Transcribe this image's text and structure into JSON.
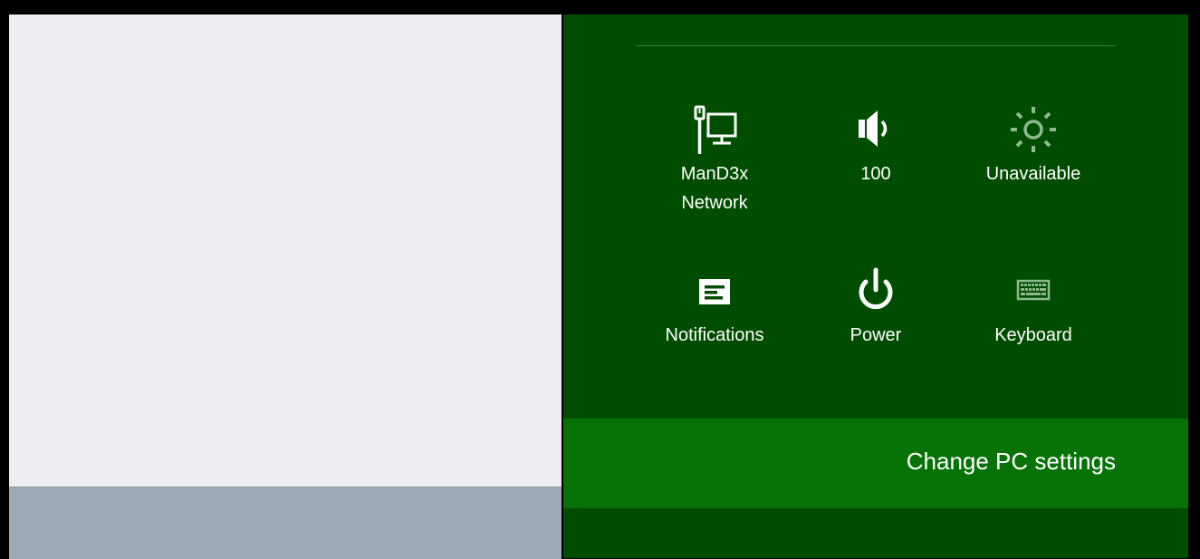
{
  "colors": {
    "charm_background": "#004D00",
    "change_pc_background": "#077307",
    "left_pane_background": "#ECEEF2",
    "left_strip_background": "#9AABB5",
    "icon_white": "#FFFFFF",
    "icon_dim": "#8FB98F"
  },
  "quick_settings": [
    {
      "label": "ManD3x\nNetwork",
      "icon": "network-wired-icon"
    },
    {
      "label": "100",
      "icon": "volume-icon"
    },
    {
      "label": "Unavailable",
      "icon": "brightness-icon"
    },
    {
      "label": "Notifications",
      "icon": "notifications-icon"
    },
    {
      "label": "Power",
      "icon": "power-icon"
    },
    {
      "label": "Keyboard",
      "icon": "keyboard-icon"
    }
  ],
  "change_pc_settings_label": "Change PC settings"
}
